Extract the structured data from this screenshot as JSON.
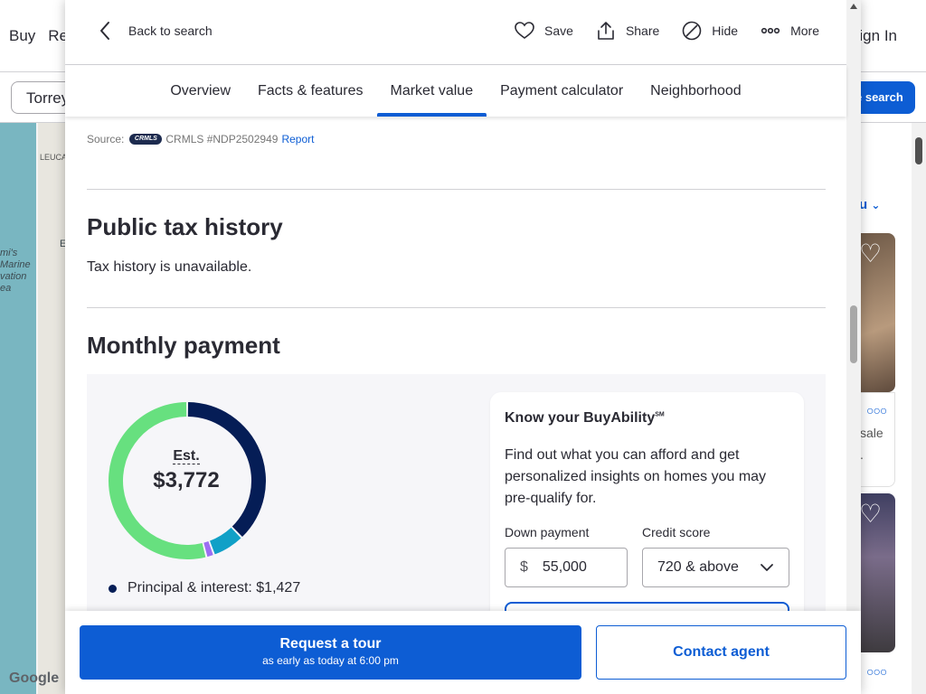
{
  "background": {
    "nav_buy": "Buy",
    "nav_rent_partial": "Re",
    "sign_in_partial": "ign In",
    "search_value_partial": "Torrey",
    "save_search_partial": "e search",
    "map_label_leuca": "LEUCA",
    "map_label_marine": "mi's\nMarine\nvation\nea",
    "map_label_e": "E",
    "google": "Google",
    "sort_partial": "u",
    "card_text_partial": "sale",
    "card_text_partial_2": "."
  },
  "header": {
    "back_label": "Back to search",
    "save_label": "Save",
    "share_label": "Share",
    "hide_label": "Hide",
    "more_label": "More"
  },
  "tabs": [
    {
      "label": "Overview"
    },
    {
      "label": "Facts & features"
    },
    {
      "label": "Market value"
    },
    {
      "label": "Payment calculator"
    },
    {
      "label": "Neighborhood"
    }
  ],
  "active_tab": "Market value",
  "source": {
    "prefix": "Source:",
    "logo_text": "CRMLS",
    "mls_id": "CRMLS #NDP2502949",
    "report_label": "Report"
  },
  "tax": {
    "title": "Public tax history",
    "message": "Tax history is unavailable."
  },
  "payment": {
    "title": "Monthly payment",
    "est_label": "Est.",
    "est_amount": "$3,772",
    "legend": [
      {
        "label": "Principal & interest: $1,427",
        "color": "#051d56"
      }
    ],
    "donut_segments": [
      {
        "name": "principal-interest",
        "value": 1427,
        "color": "#051d56"
      },
      {
        "name": "segment-teal",
        "value": 250,
        "color": "#11a0c7"
      },
      {
        "name": "segment-purple",
        "value": 60,
        "color": "#9c6ef2"
      },
      {
        "name": "segment-green",
        "value": 2035,
        "color": "#67e07f"
      }
    ]
  },
  "buyability": {
    "title": "Know your BuyAbility",
    "title_sup": "SM",
    "description": "Find out what you can afford and get personalized insights on homes you may pre-qualify for.",
    "down_payment_label": "Down payment",
    "down_payment_currency": "$",
    "down_payment_value": "55,000",
    "credit_score_label": "Credit score",
    "credit_score_value": "720 & above"
  },
  "footer": {
    "request_tour": "Request a tour",
    "request_tour_sub": "as early as today at 6:00 pm",
    "contact_agent": "Contact agent"
  }
}
